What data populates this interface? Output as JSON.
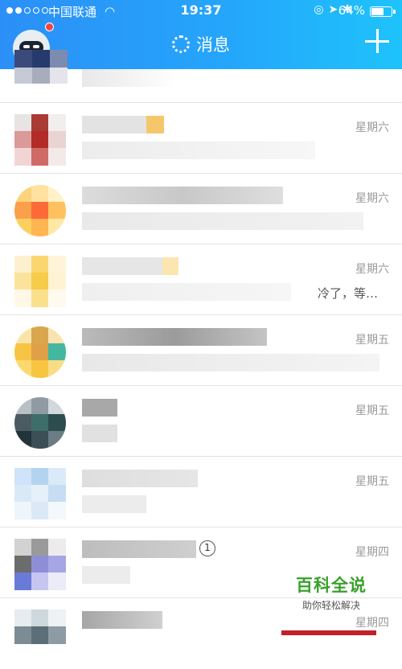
{
  "status_bar": {
    "signal_bars_filled": 2,
    "signal_bars_total": 5,
    "carrier": "中国联通",
    "time": "19:37",
    "battery_percent": "64%",
    "battery_level": 0.64
  },
  "nav": {
    "title": "消息",
    "avatar_badge_color": "#f0473f",
    "add_icon": "plus-icon"
  },
  "conversations": [
    {
      "date": "",
      "tail": ""
    },
    {
      "date": "星期六",
      "tail": ""
    },
    {
      "date": "星期六",
      "tail": ""
    },
    {
      "date": "星期六",
      "tail": "冷了，等…"
    },
    {
      "date": "星期五",
      "tail": ""
    },
    {
      "date": "星期五",
      "tail": ""
    },
    {
      "date": "星期五",
      "tail": ""
    },
    {
      "date": "星期四",
      "tail": "",
      "unread_count": "1"
    },
    {
      "date": "星期四",
      "tail": ""
    }
  ],
  "watermark": {
    "main": "百科全说",
    "sub": "助你轻松解决"
  },
  "colors": {
    "header_gradient_start": "#2b8ff7",
    "header_gradient_end": "#1ec3fb",
    "date_text": "#9a9a9a",
    "watermark_green": "#38a12a"
  }
}
